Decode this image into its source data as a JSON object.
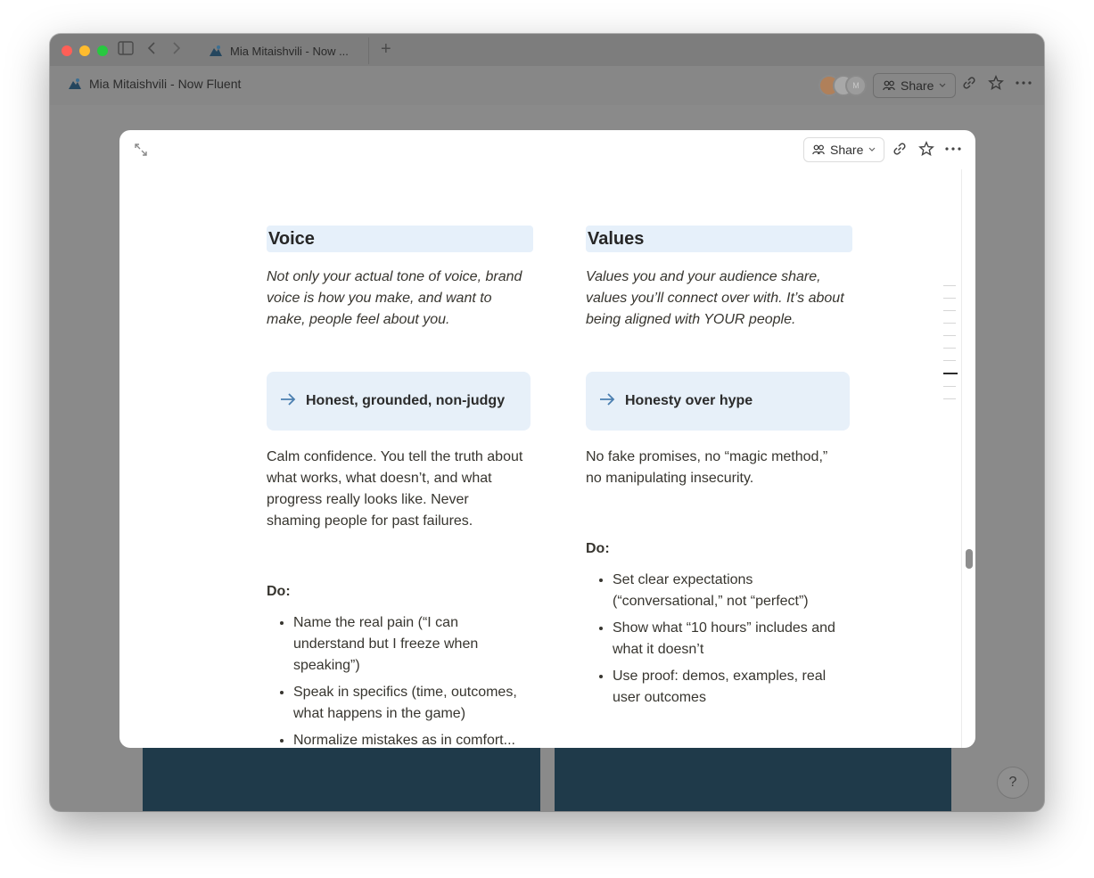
{
  "browser": {
    "tab_title": "Mia Mitaishvili - Now ...",
    "new_tab_glyph": "+"
  },
  "app": {
    "breadcrumb_title": "Mia Mitaishvili - Now Fluent",
    "share_label": "Share",
    "avatar_initial": "M"
  },
  "modal": {
    "share_label": "Share",
    "left_column": {
      "heading": "Voice",
      "intro": "Not only your actual tone of voice, brand voice is how you make, and want to make, people feel about you.",
      "callout": "Honest, grounded, non-judgy",
      "body": "Calm confidence. You tell the truth about what works, what doesn’t, and what progress really looks like. Never shaming people for past failures.",
      "do_label": "Do:",
      "do_items": [
        "Name the real pain (“I can understand but I freeze when speaking”)",
        "Speak in specifics (time, outcomes, what happens in the game)",
        "Normalize mistakes as in comfort..."
      ]
    },
    "right_column": {
      "heading": "Values",
      "intro": "Values you and your audience share, values you’ll connect over with. It’s about being aligned with YOUR people.",
      "callout": "Honesty over hype",
      "body": "No fake promises, no “magic method,” no manipulating insecurity.",
      "do_label": "Do:",
      "do_items": [
        "Set clear expectations (“conversational,” not “perfect”)",
        "Show what “10 hours” includes and what it doesn’t",
        "Use proof: demos, examples, real user outcomes"
      ]
    }
  },
  "help": {
    "label": "?"
  },
  "colors": {
    "heading_bg": "#e6f0fa",
    "callout_bg": "#e7f0f9",
    "arrow": "#4b7fb0",
    "background_panel": "#1f3a4a"
  }
}
